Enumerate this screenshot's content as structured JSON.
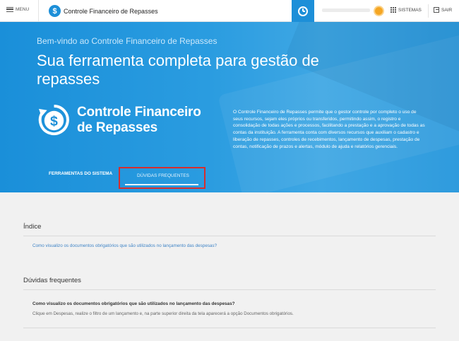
{
  "topbar": {
    "menu_label": "MENU",
    "brand_logo_glyph": "$",
    "brand_name": "Controle Financeiro de Repasses",
    "sistemas_label": "SISTEMAS",
    "sair_label": "SAIR"
  },
  "hero": {
    "welcome": "Bem-vindo ao Controle Financeiro de Repasses",
    "headline": "Sua ferramenta completa para gestão de repasses",
    "logo_line1": "Controle Financeiro",
    "logo_line2": "de Repasses",
    "description": "O Controle Financeiro de Repasses permite que o gestor controle por completo o uso de seus recursos, sejam eles próprios ou transferidos, permitindo assim, o registro e consolidação de todas ações e processos, facilitando a prestação e a aprovação de todas as contas da instituição. A ferramenta conta com diversos recursos que auxiliam o cadastro e liberação de repasses, controles de recebimentos, lançamento de despesas, prestação de contas, notificação de prazos e alertas, módulo de ajuda e relatórios gerenciais.",
    "tabs": [
      {
        "label": "FERRAMENTAS DO SISTEMA"
      },
      {
        "label": "DÚVIDAS FREQUENTES"
      }
    ]
  },
  "content": {
    "index_heading": "Índice",
    "index_link": "Como visualizo os documentos obrigatórios que são utilizados no lançamento das despesas?",
    "faq_heading": "Dúvidas frequentes",
    "faq_items": [
      {
        "question": "Como visualizo os documentos obrigatórios que são utilizados no lançamento das despesas?",
        "answer": "Clique em Despesas, realize o filtro de um lançamento e, na parte superior direita da tela aparecerá a opção Documentos obrigatórios."
      }
    ]
  },
  "colors": {
    "accent": "#1d8fd8",
    "highlight_box": "#d62d2d",
    "link": "#3f84c6"
  },
  "icons": [
    "hamburger-icon",
    "dollar-refresh-icon",
    "clock-icon",
    "sun-icon",
    "grid-icon",
    "exit-icon"
  ]
}
